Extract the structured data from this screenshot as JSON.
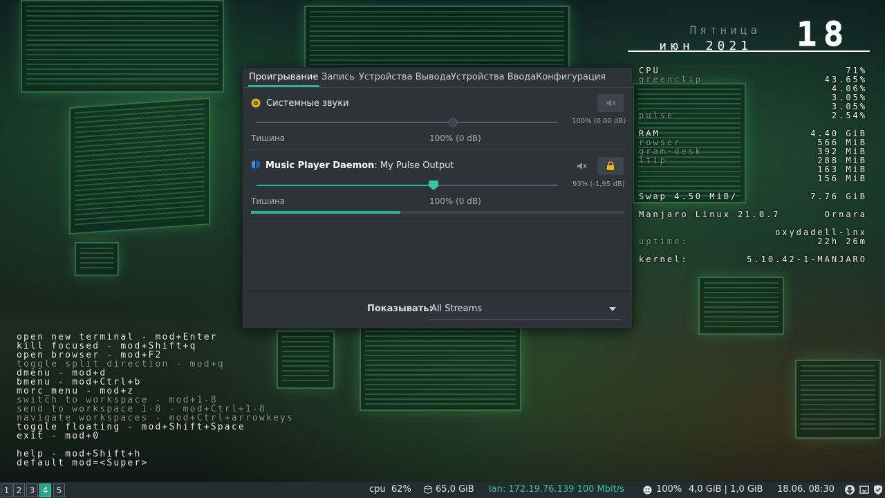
{
  "conky": {
    "day": "Пятница",
    "date": "июн 2021",
    "hour": "18",
    "rows": [
      {
        "label": "CPU",
        "value": "71%",
        "dim": false
      },
      {
        "label": "greenclip",
        "value": "43.65%",
        "dim": true
      },
      {
        "label": "",
        "value": "4.06%",
        "dim": false
      },
      {
        "label": "",
        "value": "3.05%",
        "dim": false
      },
      {
        "label": "",
        "value": "3.05%",
        "dim": false
      },
      {
        "label": "pulse",
        "value": "2.54%",
        "dim": true
      },
      {
        "label": "",
        "value": "",
        "dim": false
      },
      {
        "label": "RAM",
        "value": "4.40 GiB",
        "dim": false
      },
      {
        "label": "rowser",
        "value": "566 MiB",
        "dim": true
      },
      {
        "label": "gram-desk",
        "value": "392 MiB",
        "dim": true
      },
      {
        "label": "ltip",
        "value": "288 MiB",
        "dim": true
      },
      {
        "label": "",
        "value": "163 MiB",
        "dim": false
      },
      {
        "label": "",
        "value": "156 MiB",
        "dim": false
      },
      {
        "label": "",
        "value": "",
        "dim": false
      },
      {
        "label": "Swap 4.50 MiB/",
        "value": "7.76 GiB",
        "dim": false
      },
      {
        "label": "",
        "value": "",
        "dim": false
      },
      {
        "label": "Manjaro Linux 21.0.7",
        "value": "Ornara",
        "dim": false
      },
      {
        "label": "",
        "value": "",
        "dim": false
      },
      {
        "label": "",
        "value": "oxydadell-lnx",
        "dim": true
      },
      {
        "label": "uptime:",
        "value": "22h 26m",
        "dim": true
      },
      {
        "label": "",
        "value": "",
        "dim": false
      },
      {
        "label": "kernel:",
        "value": "5.10.42-1-MANJARO",
        "dim": false
      }
    ]
  },
  "keybindings": [
    {
      "text": "open new terminal - mod+Enter",
      "dim": false
    },
    {
      "text": "kill focused - mod+Shift+q",
      "dim": false
    },
    {
      "text": "open browser - mod+F2",
      "dim": false
    },
    {
      "text": "toggle split direction - mod+q",
      "dim": true
    },
    {
      "text": "dmenu - mod+d",
      "dim": false
    },
    {
      "text": "bmenu - mod+Ctrl+b",
      "dim": false
    },
    {
      "text": "morc_menu - mod+z",
      "dim": false
    },
    {
      "text": "switch to workspace - mod+1-8",
      "dim": true
    },
    {
      "text": "send to workspace 1-8 - mod+Ctrl+1-8",
      "dim": true
    },
    {
      "text": "navigate workspaces - mod+Ctrl+arrowkeys",
      "dim": true
    },
    {
      "text": "toggle floating - mod+Shift+Space",
      "dim": false
    },
    {
      "text": "exit - mod+0",
      "dim": false
    },
    {
      "text": "",
      "dim": false
    },
    {
      "text": "help - mod+Shift+h",
      "dim": false
    },
    {
      "text": "default mod=<Super>",
      "dim": false
    }
  ],
  "mixer": {
    "tabs": [
      "Проигрывание",
      "Запись",
      "Устройства Вывода",
      "Устройства Ввода",
      "Конфигурация"
    ],
    "active_tab": 0,
    "streams": [
      {
        "app": "Системные звуки",
        "app_bold": "",
        "stream": "",
        "icon": "system-sounds-icon",
        "volume_text": "100% (0.00 dB)",
        "volume": 1.0,
        "silence_label": "Тишина",
        "center_label": "100% (0 dB)",
        "muted": false,
        "enabled": false,
        "level": 0
      },
      {
        "app": "",
        "app_bold": "Music Player Daemon",
        "stream": ": My Pulse Output",
        "icon": "mpd-icon",
        "volume_text": "93% (-1,95 dB)",
        "volume": 0.93,
        "silence_label": "Тишина",
        "center_label": "100% (0 dB)",
        "muted": false,
        "enabled": true,
        "level": 0.4
      }
    ],
    "show_label": "Показывать:",
    "show_value": "All Streams"
  },
  "bar": {
    "workspaces": [
      "1",
      "2",
      "3",
      "4",
      "5"
    ],
    "active_workspace": 3,
    "cpu_label": "cpu",
    "cpu_value": "62%",
    "disk": "65,0 GiB",
    "lan": "lan: 172.19.76.139 100 Mbit/s",
    "volume": "100%",
    "memory": "4,0 GiB | 1,0 GiB",
    "datetime": "18.06. 08:30"
  },
  "colors": {
    "accent": "#2eb398",
    "window_bg": "#2d3338",
    "bar_bg": "#222d32"
  }
}
